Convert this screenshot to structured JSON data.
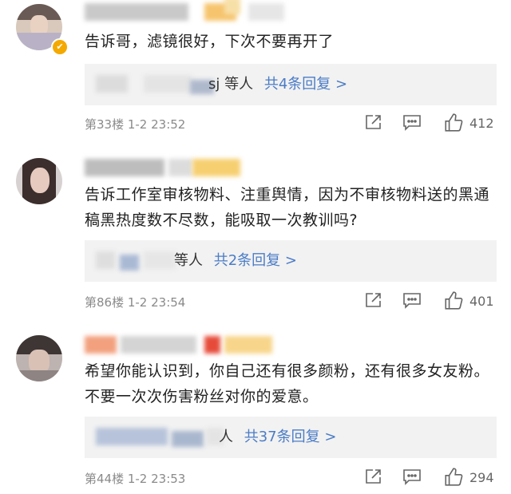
{
  "comments": [
    {
      "text": "告诉哥，滤镜很好，下次不要再开了",
      "reply_suffix": "sj 等人",
      "reply_link": "共4条回复 >",
      "meta": "第33楼 1-2 23:52",
      "likes": "412",
      "verified": true
    },
    {
      "text": "告诉工作室审核物料、注重舆情，因为不审核物料送的黑通稿黑热度数不尽数，能吸取一次教训吗?",
      "reply_suffix": "等人",
      "reply_link": "共2条回复 >",
      "meta": "第86楼 1-2 23:54",
      "likes": "401",
      "verified": false
    },
    {
      "text": "希望你能认识到，你自己还有很多颜粉，还有很多女友粉。不要一次次伤害粉丝对你的爱意。",
      "reply_suffix": "人",
      "reply_link": "共37条回复 >",
      "meta": "第44楼 1-2 23:53",
      "likes": "294",
      "verified": false
    }
  ],
  "icons": {
    "share": "share-icon",
    "comment": "comment-icon",
    "like": "like-icon",
    "verified": "verified-badge-icon"
  },
  "colors": {
    "link": "#4b7cc6",
    "reply_bg": "#f2f2f2",
    "meta": "#8a8a8a",
    "verified": "#f4a900"
  }
}
